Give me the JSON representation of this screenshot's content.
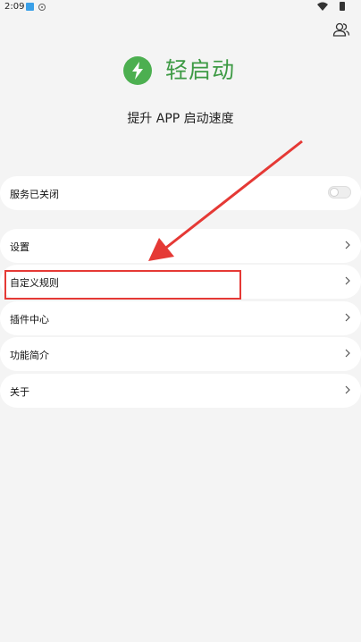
{
  "status_bar": {
    "time": "2:09",
    "icons": [
      "app-notification-icon",
      "record-icon",
      "wifi-icon",
      "battery-icon"
    ]
  },
  "header": {
    "user_icon": "users-icon"
  },
  "app": {
    "title": "轻启动",
    "subtitle": "提升 APP 启动速度",
    "brand_color": "#4caf50",
    "title_color": "#3d9a44"
  },
  "service": {
    "label": "服务已关闭",
    "enabled": false
  },
  "menu": {
    "items": [
      {
        "label": "设置"
      },
      {
        "label": "自定义规则"
      },
      {
        "label": "插件中心"
      },
      {
        "label": "功能简介"
      },
      {
        "label": "关于"
      }
    ]
  },
  "annotation": {
    "color": "#e53935",
    "target": "自定义规则"
  }
}
